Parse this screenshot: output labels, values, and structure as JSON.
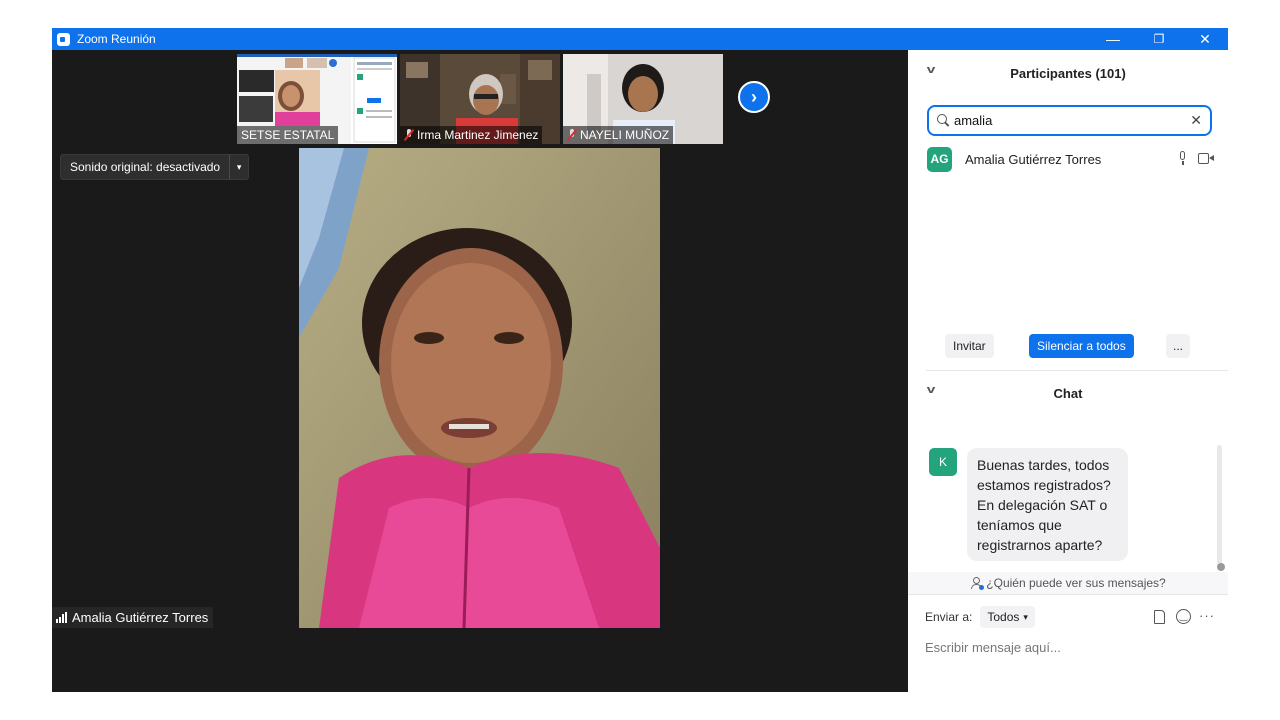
{
  "window": {
    "title": "Zoom Reunión"
  },
  "window_controls": {
    "minimize": "—",
    "restore": "❐",
    "close": "✕"
  },
  "thumbnails": [
    {
      "name": "SETSE ESTATAL",
      "muted": false
    },
    {
      "name": "Irma Martinez Jimenez",
      "muted": true
    },
    {
      "name": "NAYELI MUÑOZ",
      "muted": true
    }
  ],
  "next_page_icon": "›",
  "original_sound": {
    "label": "Sonido original: desactivado",
    "caret": "▾"
  },
  "active_speaker": {
    "name": "Amalia Gutiérrez Torres"
  },
  "participants": {
    "header": "Participantes (101)",
    "search_value": "amalia",
    "clear_icon": "✕",
    "list": [
      {
        "initials": "AG",
        "name": "Amalia Gutiérrez Torres"
      }
    ],
    "buttons": {
      "invite": "Invitar",
      "mute_all": "Silenciar a todos",
      "more": "..."
    }
  },
  "chat": {
    "header": "Chat",
    "messages": [
      {
        "initial": "K",
        "text": "Buenas tardes, todos estamos registrados? En delegación SAT o teníamos que registrarnos aparte?"
      }
    ],
    "who_can_see": "¿Quién puede ver sus mensajes?",
    "send_to_label": "Enviar a:",
    "send_to_value": "Todos",
    "send_to_caret": "▾",
    "input_placeholder": "Escribir mensaje aquí...",
    "more_icon": "···"
  },
  "colors": {
    "accent": "#0e72ed",
    "avatar_green": "#23a47d",
    "stage_bg": "#1a1a1a"
  }
}
